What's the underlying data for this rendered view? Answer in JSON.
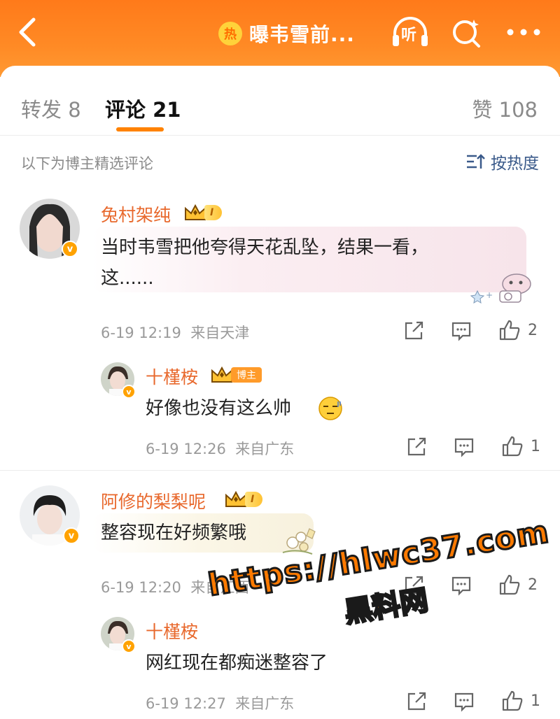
{
  "header": {
    "topic_badge": "热",
    "topic": "曝韦雪前...",
    "listen_label": "听",
    "icons": [
      "back-icon",
      "listen-icon",
      "search-icon",
      "more-icon"
    ]
  },
  "tabs": {
    "repost": "转发 8",
    "comment": "评论 21",
    "like": "赞 108"
  },
  "filter": {
    "note": "以下为博主精选评论",
    "sort_label": "按热度"
  },
  "comments": [
    {
      "username": "兔村架纯",
      "level": "I",
      "text_line1": "当时韦雪把他夸得天花乱坠，结果一看，",
      "text_line2": "这......",
      "date": "6-19 12:19",
      "location": "来自天津",
      "likes": "2",
      "reply": {
        "username": "十槿桉",
        "tag": "博主",
        "text": "好像也没有这么帅",
        "date": "6-19 12:26",
        "location": "来自广东",
        "likes": "1"
      }
    },
    {
      "username": "阿修的梨梨呢",
      "level": "I",
      "text_line1": "整容现在好频繁哦",
      "date": "6-19 12:20",
      "location": "来自江西",
      "likes": "2",
      "reply": {
        "username": "十槿桉",
        "text": "网红现在都痴迷整容了",
        "date": "6-19 12:27",
        "location": "来自广东",
        "likes": "1"
      }
    }
  ],
  "watermark": {
    "url": "https://hlwc37.com",
    "name": "黑料网"
  },
  "colors": {
    "header_orange": "#ff7a1a",
    "accent": "#ff8200",
    "username": "#e8682c"
  }
}
